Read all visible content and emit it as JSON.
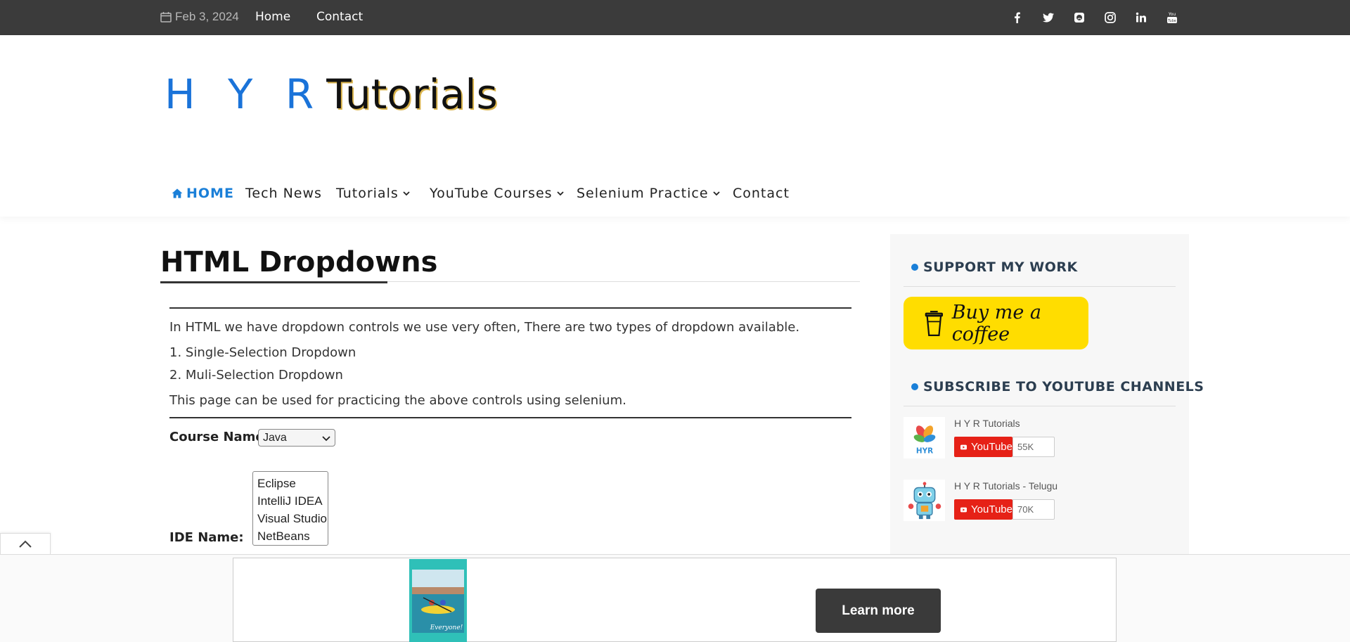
{
  "topbar": {
    "date": "Feb 3, 2024",
    "links": [
      "Home",
      "Contact"
    ],
    "social_icons": [
      "facebook-icon",
      "twitter-icon",
      "github-icon",
      "instagram-icon",
      "linkedin-icon",
      "youtube-icon"
    ]
  },
  "logo": {
    "part1": "H Y R",
    "part2": "Tutorials"
  },
  "nav": {
    "home": "HOME",
    "tech_news": "Tech News",
    "tutorials": "Tutorials",
    "youtube_courses": "YouTube Courses",
    "selenium_practice": "Selenium Practice",
    "contact": "Contact"
  },
  "main": {
    "title": "HTML Dropdowns",
    "intro": "In HTML we have dropdown controls we use very often, There are two types of dropdown available.",
    "item1": "1. Single-Selection Dropdown",
    "item2": "2. Muli-Selection Dropdown",
    "note": "This page can be used for practicing the above controls using selenium.",
    "course_label": "Course Name:",
    "course_selected": "Java",
    "ide_label": "IDE Name:",
    "ide_options": [
      "Eclipse",
      "IntelliJ IDEA",
      "Visual Studio",
      "NetBeans"
    ]
  },
  "sidebar": {
    "support_title": "SUPPORT MY WORK",
    "coffee_label": "Buy me a coffee",
    "subscribe_title": "SUBSCRIBE TO YOUTUBE CHANNELS",
    "channels": [
      {
        "name": "H Y R Tutorials",
        "button": "YouTube",
        "count": "55K"
      },
      {
        "name": "H Y R Tutorials - Telugu",
        "button": "YouTube",
        "count": "70K"
      }
    ]
  },
  "ad": {
    "cta": "Learn more",
    "image_caption": "Everyone!"
  },
  "colors": {
    "accent": "#1a7fd8",
    "topbar": "#3b3b3b",
    "youtube": "#e62117",
    "coffee": "#ffdd00"
  }
}
